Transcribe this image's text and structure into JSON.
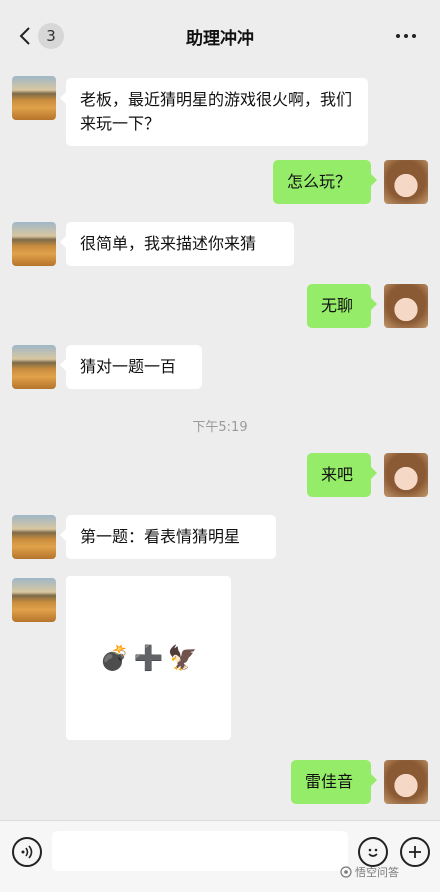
{
  "header": {
    "unread_count": "3",
    "title": "助理冲冲"
  },
  "messages": [
    {
      "side": "left",
      "text": "老板，最近猜明星的游戏很火啊，我们来玩一下？"
    },
    {
      "side": "right",
      "text": "怎么玩？"
    },
    {
      "side": "left",
      "text": "很简单，我来描述你来猜"
    },
    {
      "side": "right",
      "text": "无聊"
    },
    {
      "side": "left",
      "text": "猜对一题一百"
    },
    {
      "side": "right",
      "text": "来吧"
    },
    {
      "side": "left",
      "text": "第一题：看表情猜明星"
    },
    {
      "side": "left",
      "emoji": [
        "💣",
        "➕",
        "🦅"
      ]
    },
    {
      "side": "right",
      "text": "雷佳音"
    }
  ],
  "timestamp": "下午5:19",
  "watermark": "悟空问答",
  "icons": {
    "back": "chevron-left-icon",
    "more": "more-dots-icon",
    "voice": "voice-icon",
    "emoji": "emoji-icon",
    "plus": "plus-icon"
  },
  "colors": {
    "background": "#ededed",
    "bubble_left": "#ffffff",
    "bubble_right": "#95ec69"
  }
}
